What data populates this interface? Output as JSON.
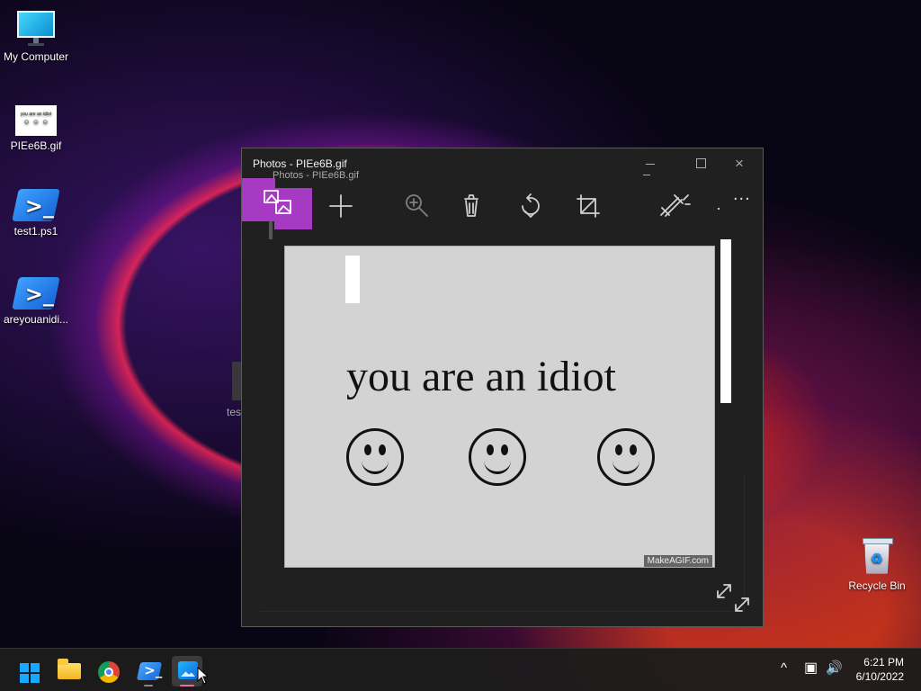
{
  "desktop": {
    "icons": [
      {
        "label": "My Computer",
        "icon": "monitor-icon"
      },
      {
        "label": "PIEe6B.gif",
        "icon": "gif-file-icon",
        "thumbnail_text": "you are an idiot"
      },
      {
        "label": "test1.ps1",
        "icon": "powershell-script-icon"
      },
      {
        "label": "areyouanidi...",
        "icon": "powershell-script-icon"
      },
      {
        "label": "Recycle Bin",
        "icon": "recycle-bin-icon"
      }
    ],
    "ghost_label": "tes"
  },
  "photos_window": {
    "title": "Photos - PIEe6B.gif",
    "ghost_title": "Photos - PIEe6B.gif",
    "controls": {
      "minimize": "minimize",
      "maximize": "maximize",
      "close": "×"
    },
    "toolbar": {
      "icons": [
        "image-gallery-icon",
        "add-icon",
        "zoom-icon",
        "delete-icon",
        "rotate-icon",
        "crop-icon",
        "edit-icon",
        "more-icon"
      ],
      "more": "..."
    },
    "image": {
      "caption": "you are an idiot",
      "watermark": "MakeAGIF.com",
      "faces": [
        "☺",
        "☺",
        "☺"
      ]
    }
  },
  "taskbar": {
    "apps": [
      {
        "name": "Start",
        "icon": "windows-icon"
      },
      {
        "name": "File Explorer",
        "icon": "folder-icon"
      },
      {
        "name": "Google Chrome",
        "icon": "chrome-icon"
      },
      {
        "name": "PowerShell",
        "icon": "powershell-icon"
      },
      {
        "name": "Photos",
        "icon": "photos-icon",
        "active": true
      }
    ],
    "tray": {
      "overflow": "^",
      "network": "▣",
      "volume": "🔊"
    },
    "clock": {
      "time": "6:21 PM",
      "date": "6/10/2022"
    }
  },
  "colors": {
    "active_toolbar": "#a73ac2",
    "photos_accent": "#1eb6ff",
    "taskbar": "#1c1c1c"
  }
}
